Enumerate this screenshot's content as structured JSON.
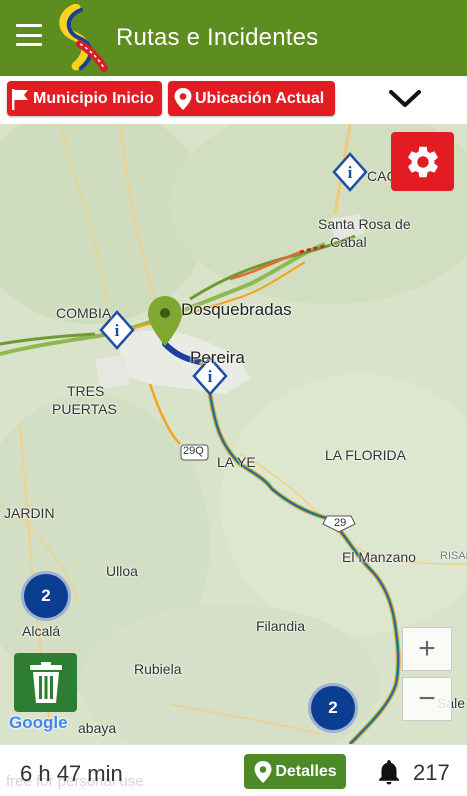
{
  "app_bar": {
    "title": "Rutas e Incidentes",
    "menu_icon": "hamburger-menu-icon",
    "logo_icon": "route-logo-icon",
    "color": "#5d8c1f"
  },
  "toolbar": {
    "origin_label": "Municipio Inicio",
    "origin_icon": "flag-icon",
    "location_label": "Ubicación Actual",
    "location_icon": "location-pin-icon",
    "expand_icon": "chevron-down-icon",
    "accent": "#e31b23"
  },
  "map": {
    "labels": {
      "cacao": "CACA",
      "santa_rosa_1": "Santa Rosa de",
      "santa_rosa_2": "Cabal",
      "combia": "COMBIA",
      "dosquebradas": "Dosquebradas",
      "pereira": "Pereira",
      "tres_puertas_1": "TRES",
      "tres_puertas_2": "PUERTAS",
      "road_290": "29Q",
      "la_ye": "LA YE",
      "la_florida": "LA FLORIDA",
      "jardin": "JARDIN",
      "road_29": "29",
      "el_manzano": "El Manzano",
      "risara": "RISAR",
      "ulloa": "Ulloa",
      "filandia": "Filandia",
      "alcala": "Alcalá",
      "rubiela": "Rubiela",
      "abaya": "abaya",
      "salento": "Sale"
    },
    "clusters": [
      {
        "count": "2"
      },
      {
        "count": "2"
      }
    ],
    "settings_icon": "gear-icon",
    "trash_icon": "trash-icon",
    "zoom_in": "+",
    "zoom_out": "−",
    "attribution": "Google"
  },
  "bottom_bar": {
    "duration": "6 h 47 min",
    "watermark": "free for personal use",
    "details_label": "Detalles",
    "details_icon": "location-pin-icon",
    "alerts_icon": "bell-icon",
    "alert_count": "217",
    "details_color": "#4b8b27"
  }
}
